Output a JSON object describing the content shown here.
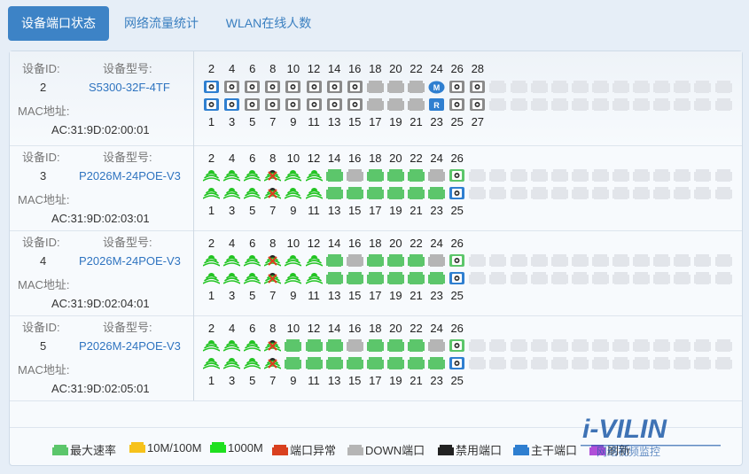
{
  "tabs": [
    {
      "label": "设备端口状态",
      "active": true
    },
    {
      "label": "网络流量统计",
      "active": false
    },
    {
      "label": "WLAN在线人数",
      "active": false
    }
  ],
  "labels": {
    "device_id": "设备ID:",
    "device_model": "设备型号:",
    "mac": "MAC地址:"
  },
  "devices": [
    {
      "id": "2",
      "model": "S5300-32F-4TF",
      "mac": "AC:31:9D:02:00:01",
      "top_numbers": [
        "2",
        "4",
        "6",
        "8",
        "10",
        "12",
        "14",
        "16",
        "18",
        "20",
        "22",
        "24",
        "26",
        "28"
      ],
      "bottom_numbers": [
        "1",
        "3",
        "5",
        "7",
        "9",
        "11",
        "13",
        "15",
        "17",
        "19",
        "21",
        "23",
        "25",
        "27"
      ],
      "top_ports": [
        "fiber-trunk",
        "fiber",
        "fiber",
        "fiber",
        "fiber",
        "fiber",
        "fiber",
        "fiber",
        "down",
        "down",
        "down",
        "mgmt",
        "fiber",
        "fiber"
      ],
      "bottom_ports": [
        "fiber-trunk",
        "fiber-trunk",
        "fiber",
        "fiber",
        "fiber",
        "fiber",
        "fiber",
        "fiber",
        "down",
        "down",
        "down",
        "rst",
        "fiber",
        "fiber"
      ]
    },
    {
      "id": "3",
      "model": "P2026M-24POE-V3",
      "mac": "AC:31:9D:02:03:01",
      "top_numbers": [
        "2",
        "4",
        "6",
        "8",
        "10",
        "12",
        "14",
        "16",
        "18",
        "20",
        "22",
        "24",
        "26"
      ],
      "bottom_numbers": [
        "1",
        "3",
        "5",
        "7",
        "9",
        "11",
        "13",
        "15",
        "17",
        "19",
        "21",
        "23",
        "25"
      ],
      "top_ports": [
        "poe",
        "poe",
        "poe",
        "poe-err",
        "poe",
        "poe",
        "max",
        "down",
        "max",
        "max",
        "max",
        "down",
        "fiber-green"
      ],
      "bottom_ports": [
        "poe",
        "poe",
        "poe",
        "poe-err",
        "poe",
        "poe",
        "max",
        "max",
        "max",
        "max",
        "max",
        "max",
        "fiber-trunk"
      ]
    },
    {
      "id": "4",
      "model": "P2026M-24POE-V3",
      "mac": "AC:31:9D:02:04:01",
      "top_numbers": [
        "2",
        "4",
        "6",
        "8",
        "10",
        "12",
        "14",
        "16",
        "18",
        "20",
        "22",
        "24",
        "26"
      ],
      "bottom_numbers": [
        "1",
        "3",
        "5",
        "7",
        "9",
        "11",
        "13",
        "15",
        "17",
        "19",
        "21",
        "23",
        "25"
      ],
      "top_ports": [
        "poe",
        "poe",
        "poe",
        "poe-dis",
        "poe",
        "poe",
        "max",
        "down",
        "max",
        "max",
        "max",
        "down",
        "fiber-green"
      ],
      "bottom_ports": [
        "poe",
        "poe",
        "poe",
        "poe-err",
        "poe",
        "poe",
        "max",
        "max",
        "max",
        "max",
        "max",
        "max",
        "fiber-trunk"
      ]
    },
    {
      "id": "5",
      "model": "P2026M-24POE-V3",
      "mac": "AC:31:9D:02:05:01",
      "top_numbers": [
        "2",
        "4",
        "6",
        "8",
        "10",
        "12",
        "14",
        "16",
        "18",
        "20",
        "22",
        "24",
        "26"
      ],
      "bottom_numbers": [
        "1",
        "3",
        "5",
        "7",
        "9",
        "11",
        "13",
        "15",
        "17",
        "19",
        "21",
        "23",
        "25"
      ],
      "top_ports": [
        "poe",
        "poe",
        "poe",
        "poe-dis",
        "max",
        "max",
        "max",
        "down",
        "max",
        "max",
        "max",
        "down",
        "fiber-green"
      ],
      "bottom_ports": [
        "poe",
        "poe",
        "poe",
        "poe-err",
        "max",
        "max",
        "max",
        "max",
        "max",
        "max",
        "max",
        "max",
        "fiber-trunk"
      ]
    }
  ],
  "legend": [
    {
      "label": "最大速率",
      "color": "#5cc66b"
    },
    {
      "label": "10M/100M",
      "color": "#f6c21b"
    },
    {
      "label": "1000M",
      "color": "#1fe01f"
    },
    {
      "label": "端口异常",
      "color": "#d9401f"
    },
    {
      "label": "DOWN端口",
      "color": "#b5b5b5"
    },
    {
      "label": "禁用端口",
      "color": "#222222"
    },
    {
      "label": "主干端口",
      "color": "#2f7fd0"
    },
    {
      "label": "刷新",
      "color": "#b04fd8"
    }
  ],
  "watermark": {
    "logo": "i-VILIN",
    "sub": "网络视频监控"
  },
  "colors": {
    "max": "#5cc66b",
    "down": "#b5b5b5",
    "empty": "#e2e5ea",
    "trunk": "#2f7fd0",
    "fiber": "#8a8a8a",
    "error": "#d9401f",
    "disabled": "#222222",
    "poe_wave": "#22c422"
  }
}
